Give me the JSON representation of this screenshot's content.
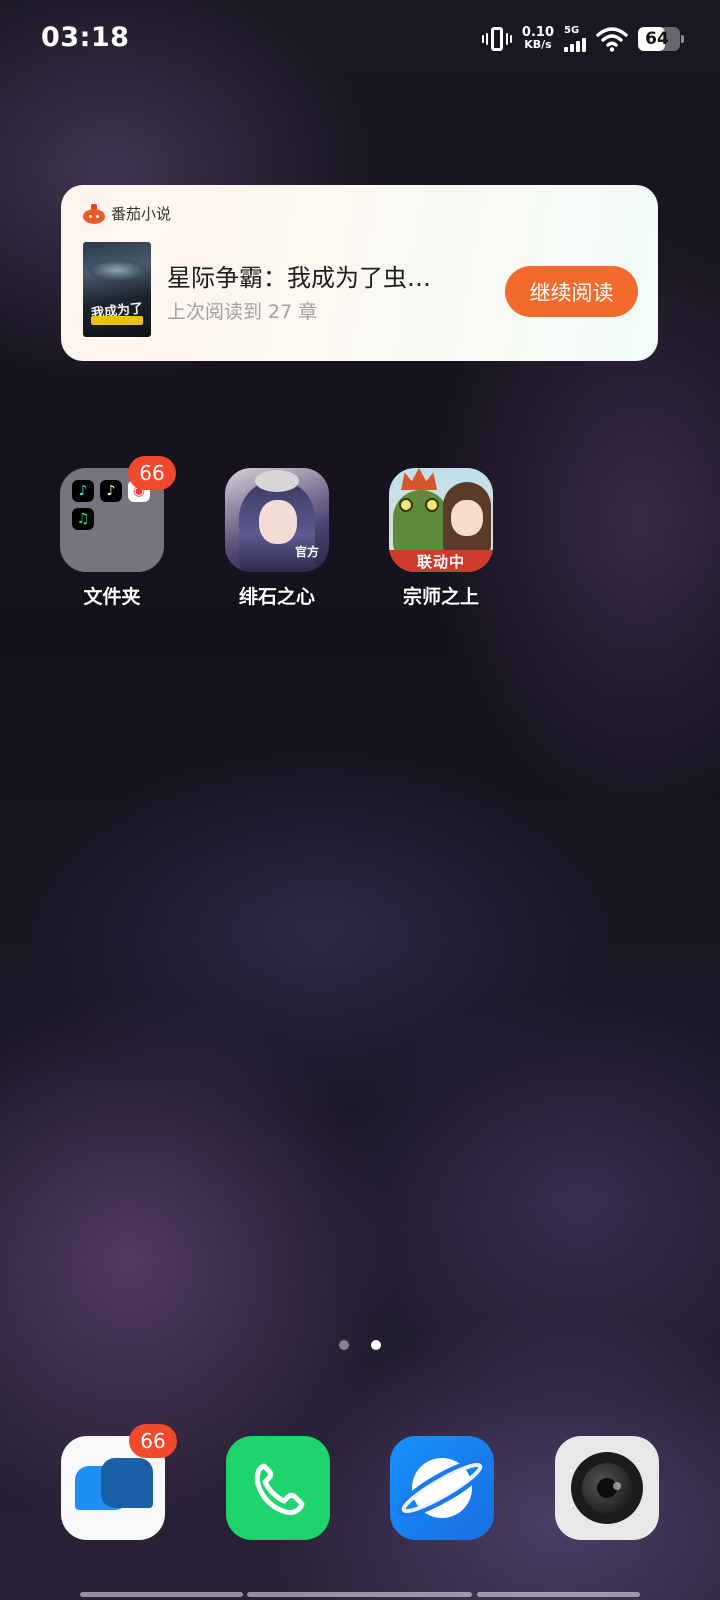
{
  "status_bar": {
    "time": "03:18",
    "net_speed_value": "0.10",
    "net_speed_unit": "KB/s",
    "network_type": "5G",
    "battery": "64",
    "battery_level_percent": 64
  },
  "widget": {
    "app_name": "番茄小说",
    "book_title": "星际争霸：我成为了虫…",
    "progress": "上次阅读到 27 章",
    "continue_label": "继续阅读",
    "accent_color": "#f26b2c"
  },
  "apps": [
    {
      "label": "文件夹",
      "badge": "66"
    },
    {
      "label": "绯石之心",
      "icon_tag": "官方"
    },
    {
      "label": "宗师之上",
      "icon_tag": "联动中"
    }
  ],
  "page_indicator": {
    "pages": 2,
    "current": 2
  },
  "dock": [
    {
      "name": "messages",
      "badge": "66",
      "icon": "message-bubbles-icon"
    },
    {
      "name": "phone",
      "icon": "phone-handset-icon"
    },
    {
      "name": "browser",
      "icon": "planet-browser-icon"
    },
    {
      "name": "camera",
      "icon": "camera-lens-icon"
    }
  ]
}
